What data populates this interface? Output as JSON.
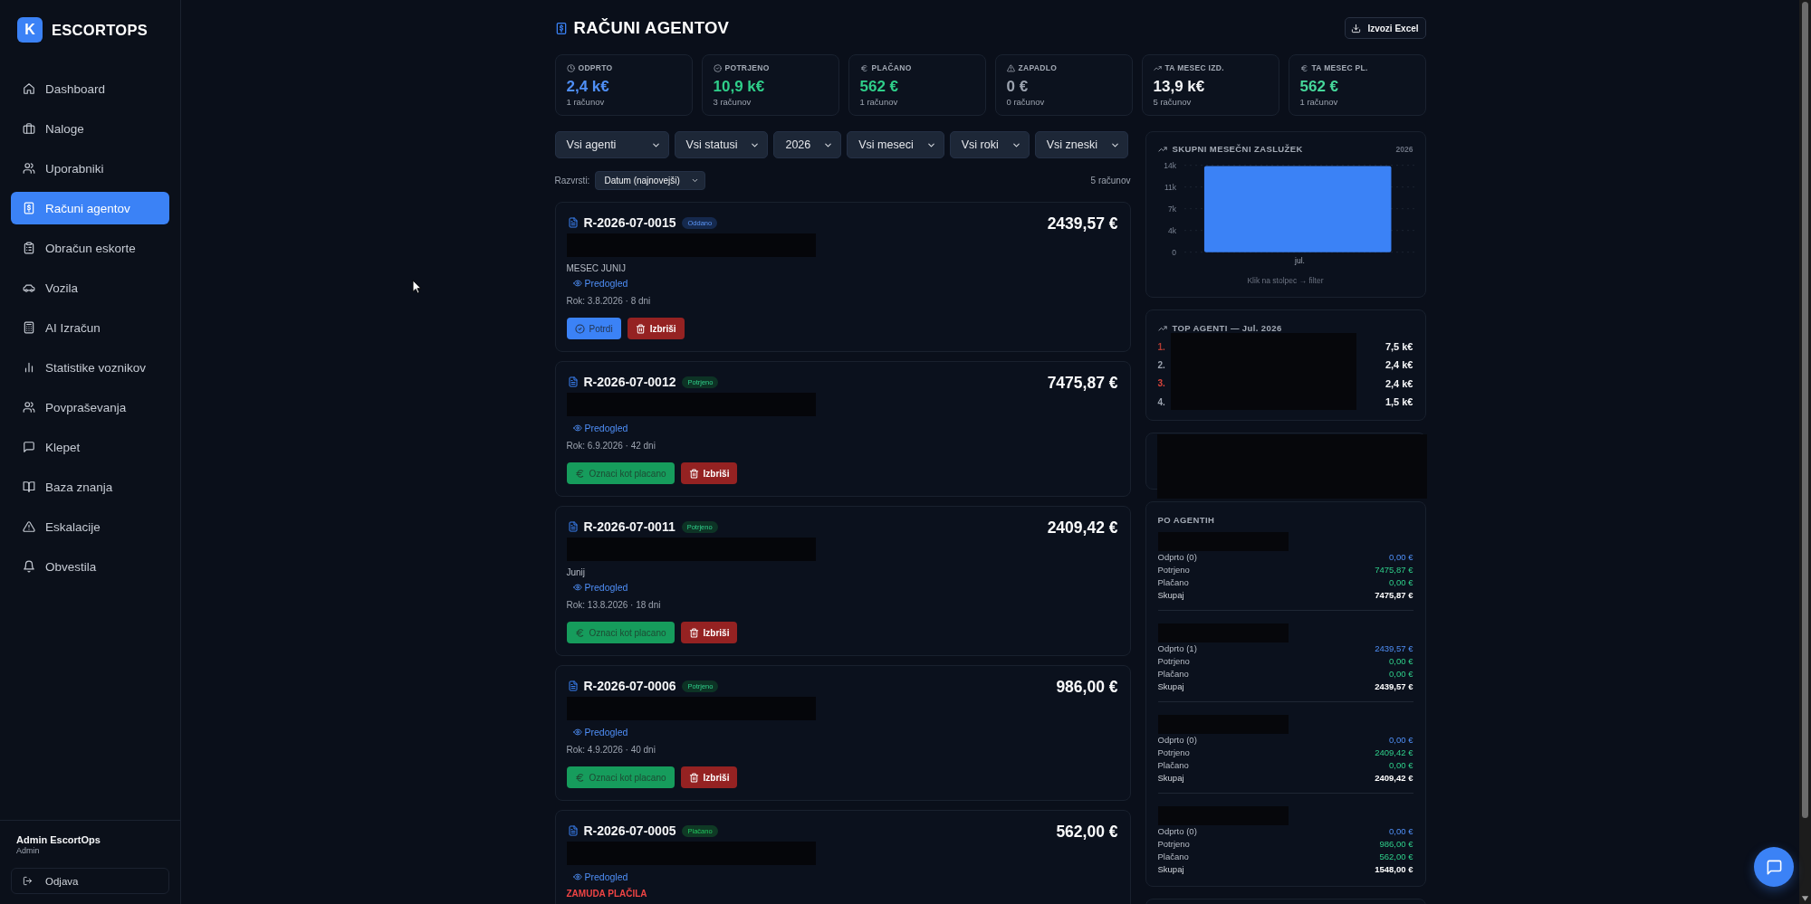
{
  "sidebar": {
    "logo_letter": "K",
    "brand": "ESCORTOPS",
    "items": [
      {
        "label": "Dashboard",
        "selected": false
      },
      {
        "label": "Naloge",
        "selected": false
      },
      {
        "label": "Uporabniki",
        "selected": false
      },
      {
        "label": "Računi agentov",
        "selected": true
      },
      {
        "label": "Obračun eskorte",
        "selected": false
      },
      {
        "label": "Vozila",
        "selected": false
      },
      {
        "label": "AI Izračun",
        "selected": false
      },
      {
        "label": "Statistike voznikov",
        "selected": false
      },
      {
        "label": "Povpraševanja",
        "selected": false
      },
      {
        "label": "Klepet",
        "selected": false
      },
      {
        "label": "Baza znanja",
        "selected": false
      },
      {
        "label": "Eskalacije",
        "selected": false
      },
      {
        "label": "Obvestila",
        "selected": false
      }
    ],
    "user": {
      "name": "Admin EscortOps",
      "role": "Admin"
    },
    "logout": "Odjava"
  },
  "header": {
    "title": "RAČUNI AGENTOV",
    "export_button": "Izvozi Excel"
  },
  "stats": [
    {
      "label": "ODPRTO",
      "value": "2,4 k€",
      "sub": "1 računov",
      "color": "#4f8ff7"
    },
    {
      "label": "POTRJENO",
      "value": "10,9 k€",
      "sub": "3 računov",
      "color": "#2fcf8a"
    },
    {
      "label": "PLAČANO",
      "value": "562 €",
      "sub": "1 računov",
      "color": "#2fcf8a"
    },
    {
      "label": "ZAPADLO",
      "value": "0 €",
      "sub": "0 računov",
      "color": "#9ca3af"
    },
    {
      "label": "TA MESEC IZD.",
      "value": "13,9 k€",
      "sub": "5 računov",
      "color": "#f3f4f6"
    },
    {
      "label": "TA MESEC PL.",
      "value": "562 €",
      "sub": "1 računov",
      "color": "#46d89b"
    }
  ],
  "filters": [
    "Vsi agenti",
    "Vsi statusi",
    "2026",
    "Vsi meseci",
    "Vsi roki",
    "Vsi zneski"
  ],
  "sort": {
    "label": "Razvrsti:",
    "value": "Datum (najnovejši)"
  },
  "count": "5 računov",
  "invoices": [
    {
      "number": "R-2026-07-0015",
      "status": {
        "kind": "submitted",
        "label": "Oddano"
      },
      "amount": "2439,57 €",
      "note": "MESEC JUNIJ",
      "preview": "Predogled",
      "due": "Rok: 3.8.2026 · 8 dni",
      "actions": [
        {
          "kind": "confirm",
          "label": "Potrdi"
        },
        {
          "kind": "delete",
          "label": "Izbriši"
        }
      ]
    },
    {
      "number": "R-2026-07-0012",
      "status": {
        "kind": "confirmed",
        "label": "Potrjeno"
      },
      "amount": "7475,87 €",
      "preview": "Predogled",
      "due": "Rok: 6.9.2026 · 42 dni",
      "actions": [
        {
          "kind": "mark_paid",
          "label": "Oznaci kot placano"
        },
        {
          "kind": "delete",
          "label": "Izbriši"
        }
      ]
    },
    {
      "number": "R-2026-07-0011",
      "status": {
        "kind": "confirmed",
        "label": "Potrjeno"
      },
      "amount": "2409,42 €",
      "note": "Junij",
      "preview": "Predogled",
      "due": "Rok: 13.8.2026 · 18 dni",
      "actions": [
        {
          "kind": "mark_paid",
          "label": "Oznaci kot placano"
        },
        {
          "kind": "delete",
          "label": "Izbriši"
        }
      ]
    },
    {
      "number": "R-2026-07-0006",
      "status": {
        "kind": "confirmed",
        "label": "Potrjeno"
      },
      "amount": "986,00 €",
      "preview": "Predogled",
      "due": "Rok: 4.9.2026 · 40 dni",
      "actions": [
        {
          "kind": "mark_paid",
          "label": "Oznaci kot placano"
        },
        {
          "kind": "delete",
          "label": "Izbriši"
        }
      ]
    },
    {
      "number": "R-2026-07-0005",
      "status": {
        "kind": "paid",
        "label": "Plačano"
      },
      "amount": "562,00 €",
      "preview": "Predogled",
      "alert": "ZAMUDA PLAČILA"
    }
  ],
  "chart_panel": {
    "year": "2026",
    "hint": "Klik na stolpec → filter",
    "chart_data": {
      "type": "bar",
      "title": "SKUPNI MESEČNI ZASLUŽEK",
      "categories": [
        "jul."
      ],
      "values": [
        13900
      ],
      "ylim": [
        0,
        14000
      ],
      "yticks": [
        {
          "value": 0,
          "label": "0"
        },
        {
          "value": 3500,
          "label": "4k"
        },
        {
          "value": 7000,
          "label": "7k"
        },
        {
          "value": 10500,
          "label": "11k"
        },
        {
          "value": 14000,
          "label": "14k"
        }
      ],
      "grid": true
    }
  },
  "top_agents": {
    "title": "TOP AGENTI — Jul. 2026",
    "items": [
      {
        "rank": "1.",
        "value": "7,5 k€",
        "color": "#b23b32"
      },
      {
        "rank": "2.",
        "value": "2,4 k€",
        "color": "#9ca3af"
      },
      {
        "rank": "3.",
        "value": "2,4 k€",
        "color": "#d9443b"
      },
      {
        "rank": "4.",
        "value": "1,5 k€",
        "color": "#9ca3af"
      }
    ]
  },
  "by_agent": {
    "title": "PO AGENTIH",
    "groups": [
      {
        "rows": [
          {
            "kind": "open",
            "label": "Odprto (0)",
            "value": "0,00 €"
          },
          {
            "kind": "confirmed",
            "label": "Potrjeno",
            "value": "7475,87 €"
          },
          {
            "kind": "paid",
            "label": "Plačano",
            "value": "0,00 €"
          },
          {
            "kind": "total",
            "label": "Skupaj",
            "value": "7475,87 €"
          }
        ]
      },
      {
        "rows": [
          {
            "kind": "open",
            "label": "Odprto (1)",
            "value": "2439,57 €"
          },
          {
            "kind": "confirmed",
            "label": "Potrjeno",
            "value": "0,00 €"
          },
          {
            "kind": "paid",
            "label": "Plačano",
            "value": "0,00 €"
          },
          {
            "kind": "total",
            "label": "Skupaj",
            "value": "2439,57 €"
          }
        ]
      },
      {
        "rows": [
          {
            "kind": "open",
            "label": "Odprto (0)",
            "value": "0,00 €"
          },
          {
            "kind": "confirmed",
            "label": "Potrjeno",
            "value": "2409,42 €"
          },
          {
            "kind": "paid",
            "label": "Plačano",
            "value": "0,00 €"
          },
          {
            "kind": "total",
            "label": "Skupaj",
            "value": "2409,42 €"
          }
        ]
      },
      {
        "rows": [
          {
            "kind": "open",
            "label": "Odprto (0)",
            "value": "0,00 €"
          },
          {
            "kind": "confirmed",
            "label": "Potrjeno",
            "value": "986,00 €"
          },
          {
            "kind": "paid",
            "label": "Plačano",
            "value": "562,00 €"
          },
          {
            "kind": "total",
            "label": "Skupaj",
            "value": "1548,00 €"
          }
        ]
      }
    ]
  }
}
